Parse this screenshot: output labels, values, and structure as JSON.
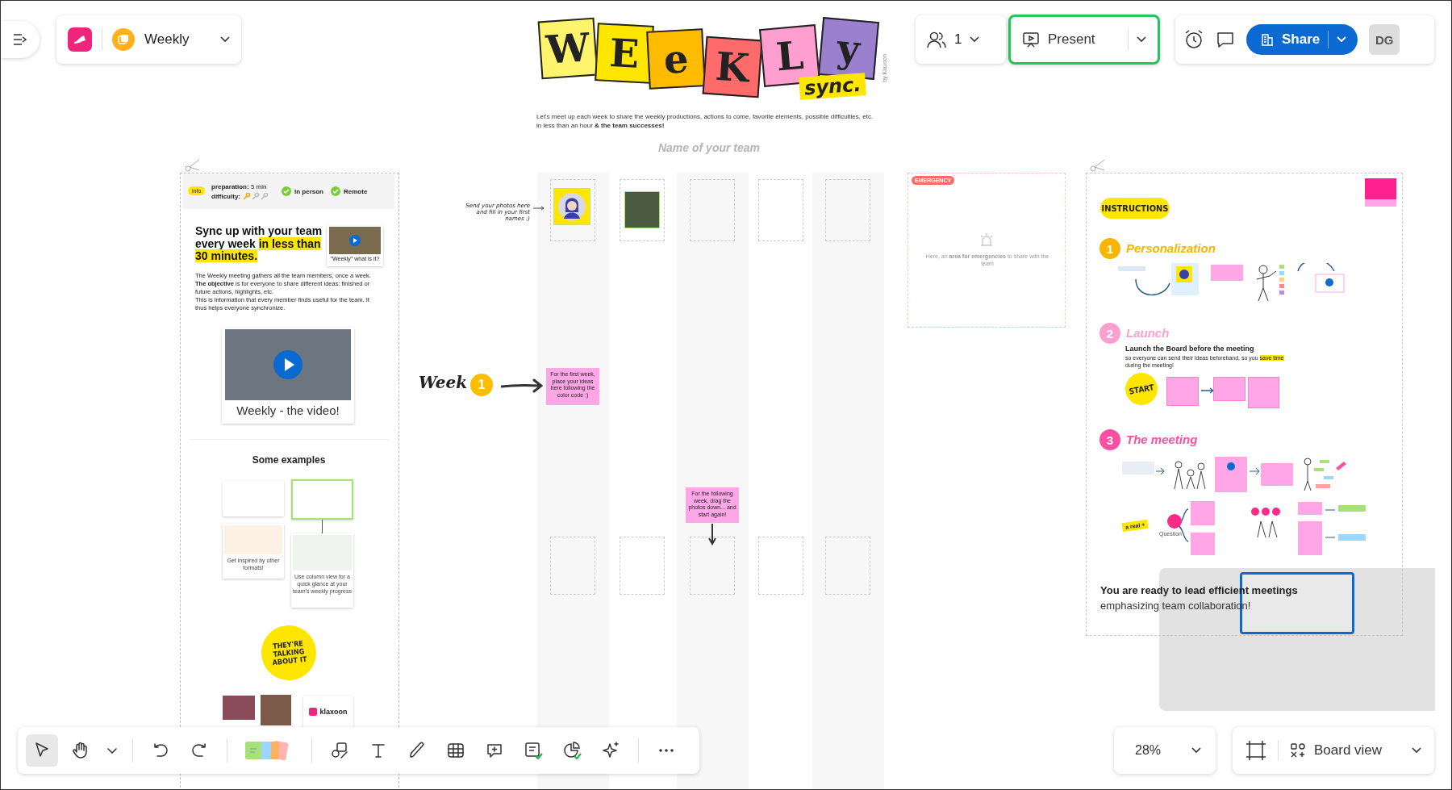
{
  "board": {
    "name": "Weekly"
  },
  "collaborators": {
    "count": "1"
  },
  "present_button": {
    "label": "Present",
    "focused": true
  },
  "share_button": {
    "label": "Share"
  },
  "user": {
    "initials": "DG"
  },
  "title_art": {
    "letters": [
      {
        "char": "W",
        "color": "#fff46b"
      },
      {
        "char": "E",
        "color": "#ffe600"
      },
      {
        "char": "e",
        "color": "#ffbb00"
      },
      {
        "char": "K",
        "color": "#ff6b6b"
      },
      {
        "char": "L",
        "color": "#ff9fd0"
      },
      {
        "char": "y",
        "color": "#9b80d0"
      }
    ],
    "tag": "sync.",
    "credit": "by Klaxoon"
  },
  "intro": {
    "line_1": "Let's meet up each week to share the weekly productions, actions to come, favorite elements, possible difficulties, etc.",
    "line_2": "in less than an hour **& the team successes!**"
  },
  "team_name_placeholder": "Name of your team",
  "guide_panel": {
    "info_badge": "info",
    "preparation": "**preparation:** 5 min",
    "difficulty_label": "difficulty:",
    "difficulty": {
      "stars": 1
    },
    "modes": [
      {
        "label": "In person",
        "checked": true
      },
      {
        "label": "Remote",
        "checked": true
      }
    ],
    "headline": {
      "text": "Sync up with your team every week",
      "highlight": "in less than 30 minutes."
    },
    "intro_video_caption": "\"Weekly\" what is it?",
    "paragraph_1": "The Weekly meeting gathers all the team members, once a week. **The objective** is for everyone to share different ideas: finished or future actions, highlights, etc.",
    "paragraph_2": "This is information that every member finds useful for the team. It thus helps everyone synchronize.",
    "video_caption": "Weekly - the video!",
    "examples_title": "Some examples",
    "example_captions": [
      "Get inspired by other formats!",
      "Use column view for a quick glance at your team's weekly progress"
    ],
    "sticker": "THEY'RE TALKING ABOUT IT",
    "logo_text": "klaxoon"
  },
  "board_area": {
    "photo_hint": "Send your photos here and fill in your first names :)",
    "week_label": "Week",
    "week_number": "1",
    "sticky_notes": [
      "For the first week, place your ideas here following the color code :)",
      "For the following week, drag the photos down... and start again!"
    ],
    "emergency": {
      "tag": "EMERGENCY",
      "text": "Here, an **area for emergencies** to share with the team"
    }
  },
  "instructions": {
    "badge": "INSTRUCTIONS",
    "steps": [
      {
        "number": "1",
        "title": "Personalization",
        "color": "#f7b500"
      },
      {
        "number": "2",
        "title": "Launch",
        "color": "#ff9fd0"
      },
      {
        "number": "3",
        "title": "The meeting",
        "color": "#ff4fa3"
      }
    ],
    "launch_heading": "Launch the Board before the meeting",
    "launch_text": "so everyone can send their ideas beforehand, so you",
    "launch_highlight": "save time",
    "launch_text_end": "during the meeting!",
    "start_badge": "START",
    "bonus_tag": "a real +",
    "question_label": "Question",
    "closing_line_1": "You are ready to lead efficient meetings",
    "closing_line_2": "emphasizing team collaboration!"
  },
  "toolbar": {
    "tool_groups": [
      [
        {
          "kind": "select",
          "selected": true
        },
        {
          "kind": "hand",
          "selected": false
        },
        {
          "kind": "caret",
          "selected": false
        }
      ],
      [
        {
          "kind": "undo",
          "selected": false
        },
        {
          "kind": "redo",
          "selected": false
        }
      ],
      [
        {
          "kind": "stickies",
          "selected": false
        }
      ],
      [
        {
          "kind": "shapes",
          "selected": false
        },
        {
          "kind": "text",
          "selected": false
        },
        {
          "kind": "pen",
          "selected": false
        },
        {
          "kind": "table",
          "selected": false
        },
        {
          "kind": "comment",
          "selected": false
        },
        {
          "kind": "form",
          "selected": false
        },
        {
          "kind": "chart",
          "selected": false
        },
        {
          "kind": "sparkle",
          "selected": false
        }
      ],
      [
        {
          "kind": "more",
          "selected": false
        }
      ]
    ]
  },
  "zoom": {
    "value": "28%"
  },
  "view": {
    "label": "Board view"
  }
}
